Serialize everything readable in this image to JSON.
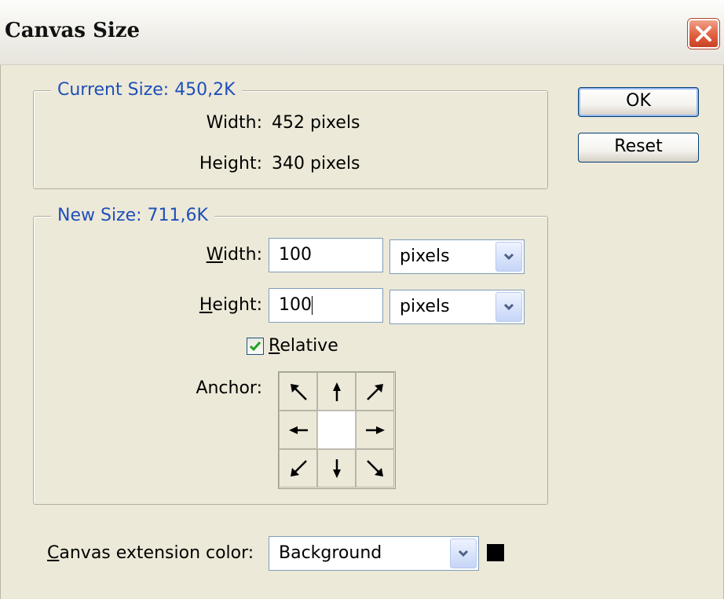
{
  "window": {
    "title": "Canvas Size"
  },
  "current_size": {
    "legend": "Current Size: 450,2K",
    "width_label": "Width:",
    "width_value": "452 pixels",
    "height_label": "Height:",
    "height_value": "340 pixels"
  },
  "new_size": {
    "legend": "New Size: 711,6K",
    "width_label_mnemonic": "W",
    "width_label_rest": "idth:",
    "width_value": "100",
    "width_unit": "pixels",
    "height_label_mnemonic": "H",
    "height_label_rest": "eight:",
    "height_value": "100",
    "height_unit": "pixels",
    "relative_mnemonic": "R",
    "relative_rest": "elative",
    "relative_checked": true,
    "anchor_label": "Anchor:"
  },
  "extension": {
    "label_mnemonic": "C",
    "label_rest": "anvas extension color:",
    "value": "Background",
    "swatch_color": "#000000"
  },
  "buttons": {
    "ok": "OK",
    "reset": "Reset"
  },
  "colors": {
    "legend_blue": "#1f4fb8",
    "dialog_bg": "#ece9d8"
  }
}
